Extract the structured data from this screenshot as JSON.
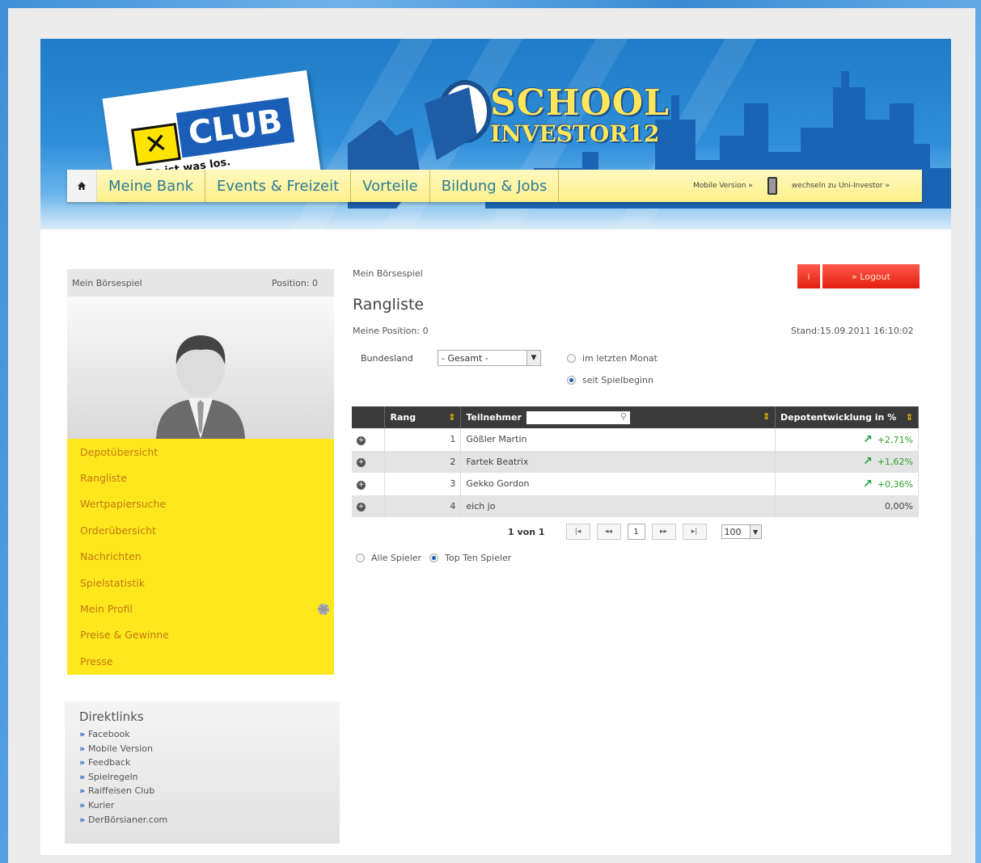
{
  "header": {
    "logo_text": "CLUB",
    "logo_tagline": "Da ist was los.",
    "game_title_line1": "SCHOOL",
    "game_title_line2": "INVESTOR12"
  },
  "nav": {
    "items": [
      "Meine Bank",
      "Events & Freizeit",
      "Vorteile",
      "Bildung & Jobs"
    ],
    "mobile_version": "Mobile Version »",
    "switch_link": "wechseln zu Uni-Investor »"
  },
  "sidebar": {
    "title": "Mein Börsespiel",
    "position_label": "Position: 0",
    "menu": [
      "Depotübersicht",
      "Rangliste",
      "Wertpapiersuche",
      "Orderübersicht",
      "Nachrichten",
      "Spielstatistik",
      "Mein Profil",
      "Preise & Gewinne",
      "Presse"
    ]
  },
  "direktlinks": {
    "title": "Direktlinks",
    "links": [
      "Facebook",
      "Mobile Version",
      "Feedback",
      "Spielregeln",
      "Raiffeisen Club",
      "Kurier",
      "DerBörsianer.com"
    ]
  },
  "main": {
    "breadcrumb": "Mein Börsespiel",
    "info_button": "i",
    "logout_button": "» Logout",
    "title": "Rangliste",
    "my_position": "Meine Position: 0",
    "stand": "Stand:15.09.2011 16:10:02",
    "bundesland_label": "Bundesland",
    "bundesland_value": "- Gesamt -",
    "period_options": [
      "im letzten Monat",
      "seit Spielbeginn"
    ],
    "period_selected": 1
  },
  "table": {
    "headers": [
      "Rang",
      "Teilnehmer",
      "Depotentwicklung in %"
    ],
    "rows": [
      {
        "rank": "1",
        "name": "Gößler Martin",
        "pct": "+2,71%",
        "trend": "up"
      },
      {
        "rank": "2",
        "name": "Fartek Beatrix",
        "pct": "+1,62%",
        "trend": "up"
      },
      {
        "rank": "3",
        "name": "Gekko Gordon",
        "pct": "+0,36%",
        "trend": "up"
      },
      {
        "rank": "4",
        "name": "eich jo",
        "pct": "0,00%",
        "trend": "none"
      }
    ]
  },
  "pager": {
    "info": "1 von 1",
    "current_page": "1",
    "page_size": "100"
  },
  "filter": {
    "options": [
      "Alle Spieler",
      "Top Ten Spieler"
    ],
    "selected": 1
  },
  "colors": {
    "accent_yellow": "#ffe71e",
    "menu_text": "#c07a10",
    "logout_red": "#e31e10",
    "positive_green": "#2ca02c",
    "header_blue": "#1f7cc8"
  }
}
